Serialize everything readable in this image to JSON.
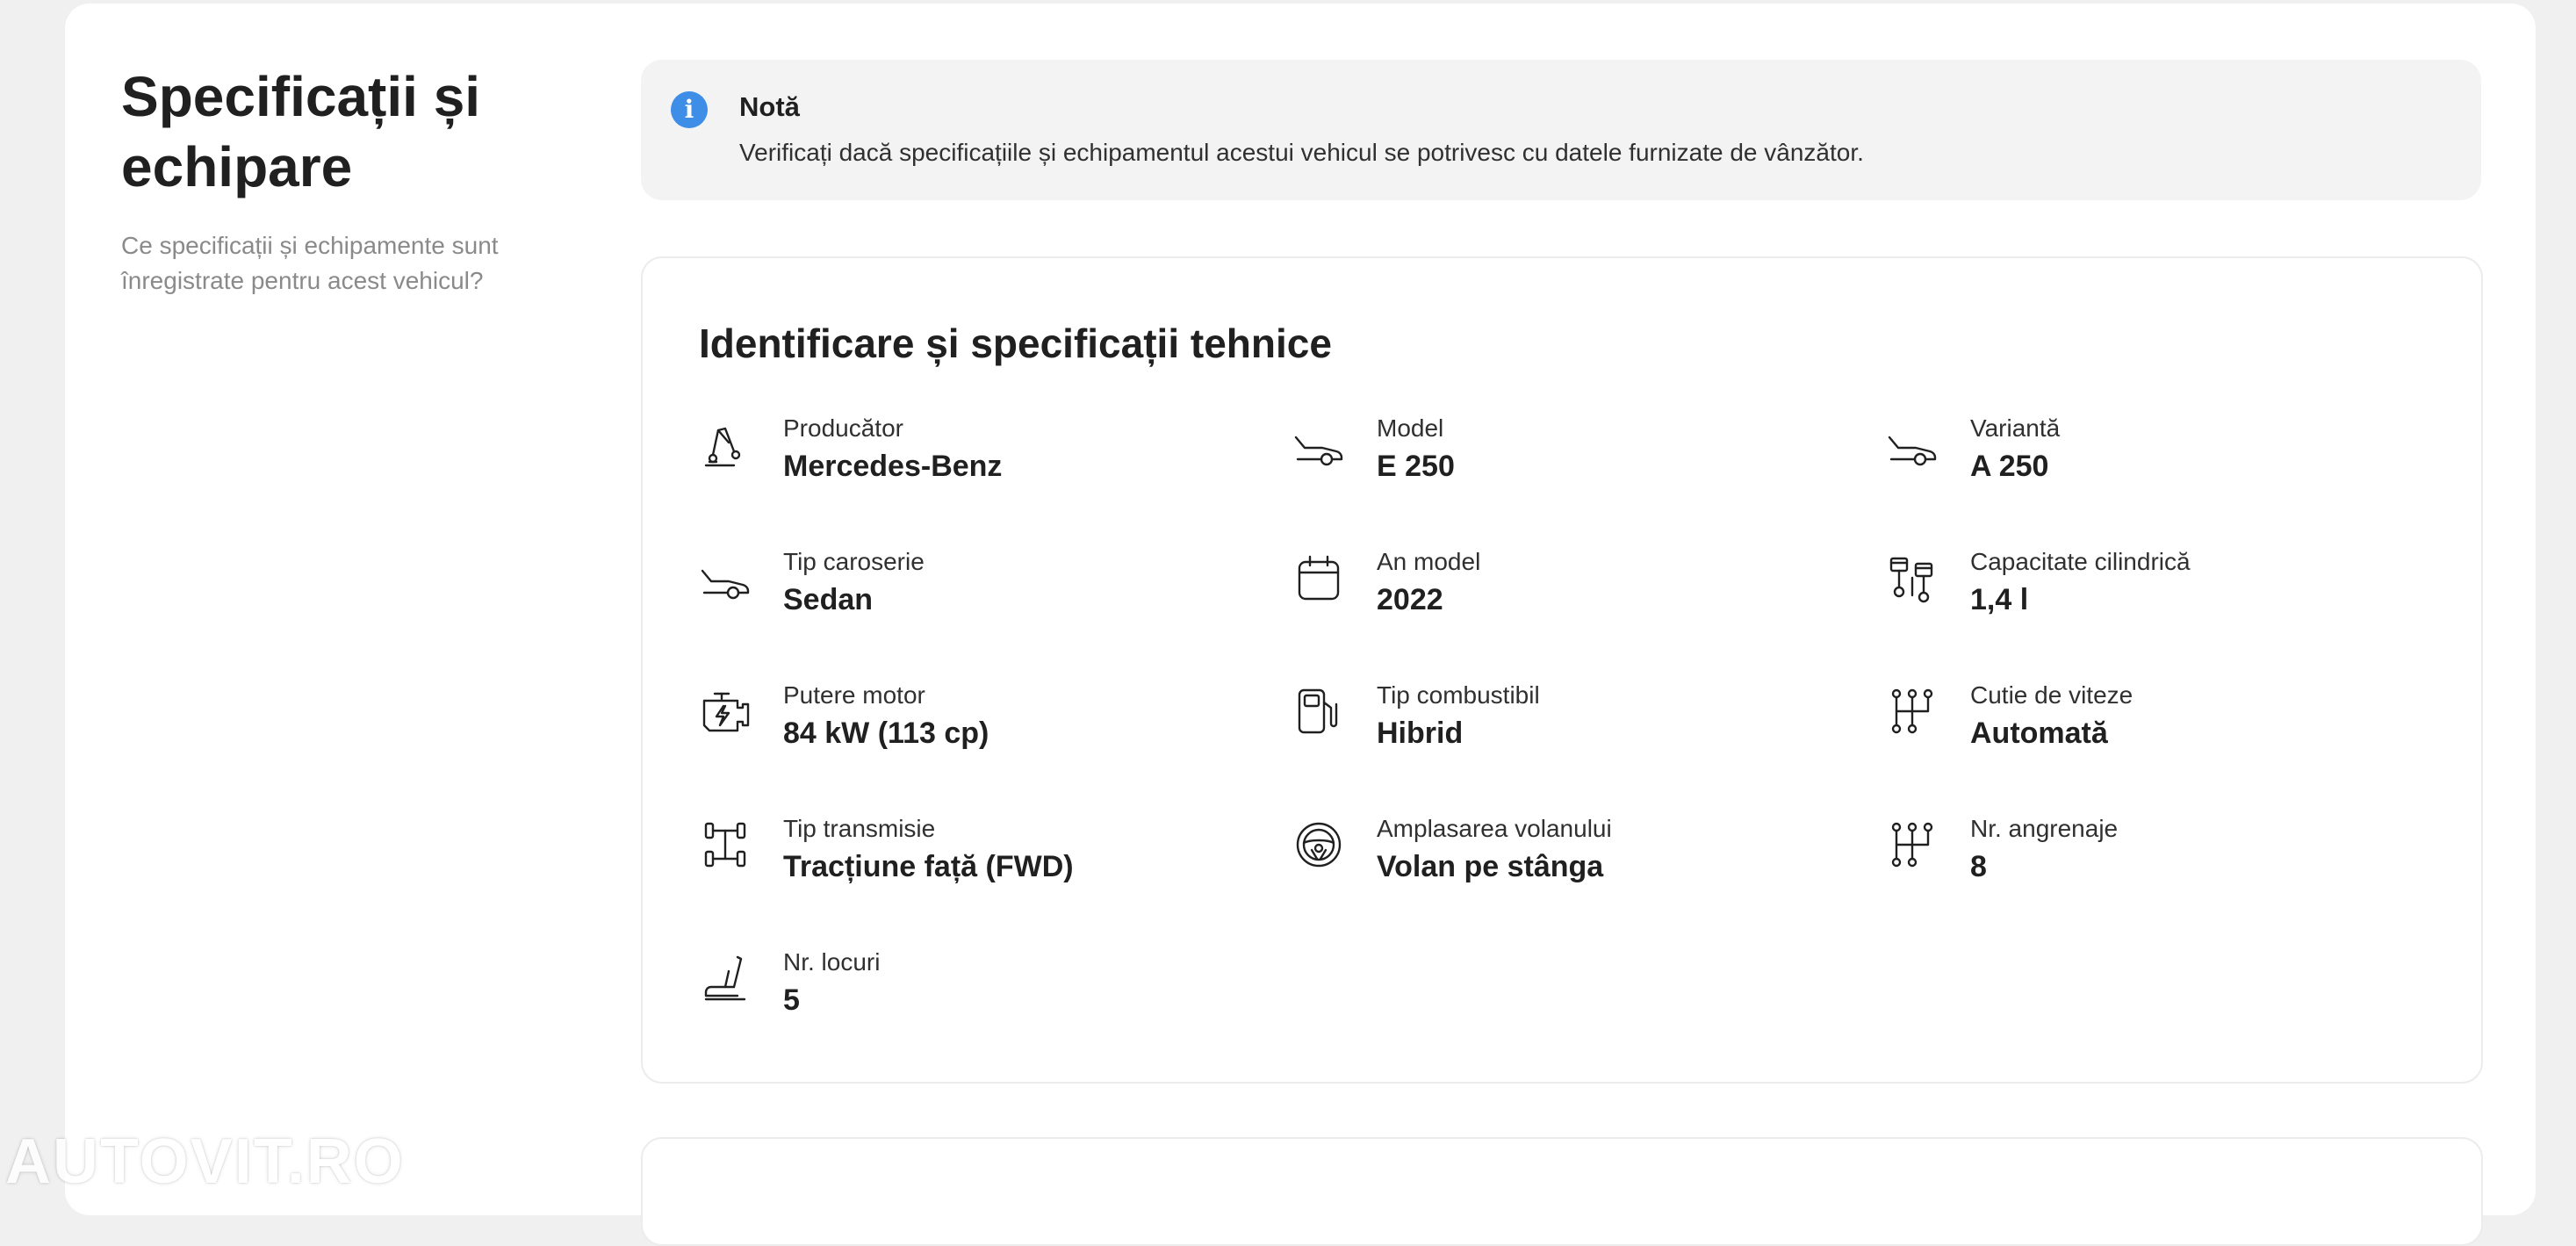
{
  "side": {
    "title": "Specificații și echipare",
    "subtitle": "Ce specificații și echipamente sunt înregistrate pentru acest vehicul?"
  },
  "note": {
    "title": "Notă",
    "text": "Verificați dacă specificațiile și echipamentul acestui vehicul se potrivesc cu datele furnizate de vânzător.",
    "icon": "info-icon",
    "icon_color": "#3e8ee8"
  },
  "specs": {
    "title": "Identificare și specificații tehnice",
    "items": [
      {
        "label": "Producător",
        "value": "Mercedes-Benz",
        "icon": "manufacturer-icon"
      },
      {
        "label": "Model",
        "value": "E 250",
        "icon": "car-icon"
      },
      {
        "label": "Variantă",
        "value": "A 250",
        "icon": "car-icon"
      },
      {
        "label": "Tip caroserie",
        "value": "Sedan",
        "icon": "car-icon"
      },
      {
        "label": "An model",
        "value": "2022",
        "icon": "calendar-icon"
      },
      {
        "label": "Capacitate cilindrică",
        "value": "1,4 l",
        "icon": "pistons-icon"
      },
      {
        "label": "Putere motor",
        "value": "84 kW (113 cp)",
        "icon": "engine-icon"
      },
      {
        "label": "Tip combustibil",
        "value": "Hibrid",
        "icon": "fuel-pump-icon"
      },
      {
        "label": "Cutie de viteze",
        "value": "Automată",
        "icon": "gearbox-icon"
      },
      {
        "label": "Tip transmisie",
        "value": "Tracțiune față (FWD)",
        "icon": "drivetrain-icon"
      },
      {
        "label": "Amplasarea volanului",
        "value": "Volan pe stânga",
        "icon": "steering-wheel-icon"
      },
      {
        "label": "Nr. angrenaje",
        "value": "8",
        "icon": "gearbox-icon"
      },
      {
        "label": "Nr. locuri",
        "value": "5",
        "icon": "seat-icon"
      }
    ]
  },
  "watermark": "AUTOVIT.RO"
}
